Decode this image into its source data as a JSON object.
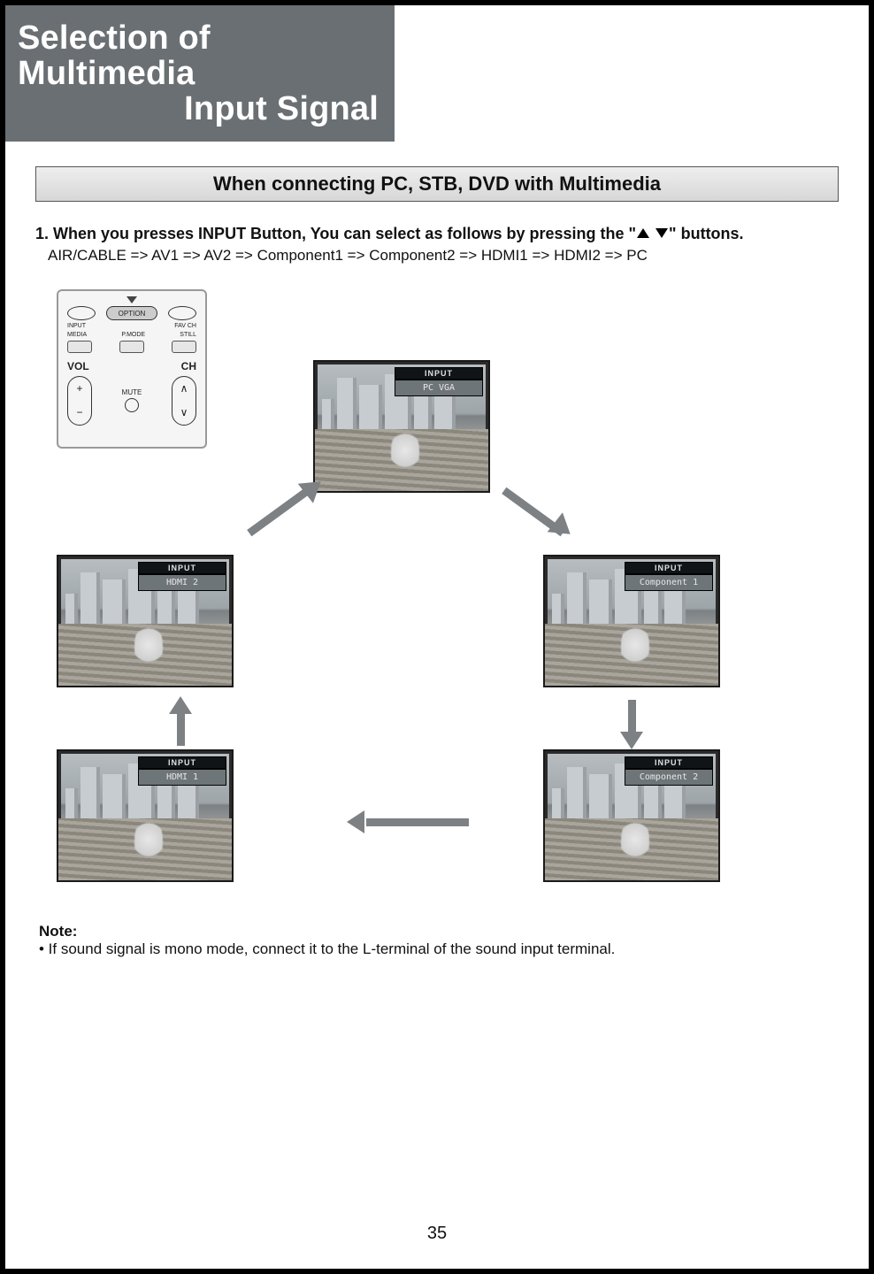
{
  "title": {
    "line1": "Selection of Multimedia",
    "line2": "Input Signal"
  },
  "section_heading": "When connecting PC, STB, DVD with Multimedia",
  "step": {
    "prefix": "1. When you presses INPUT Button, You can select as follows by pressing the \"",
    "suffix": "\" buttons.",
    "sequence": "AIR/CABLE => AV1 => AV2 => Component1 => Component2 => HDMI1 => HDMI2 => PC"
  },
  "remote": {
    "option": "OPTION",
    "input": "INPUT",
    "favch": "FAV CH",
    "media": "MEDIA",
    "pmode": "P.MODE",
    "still": "STILL",
    "vol": "VOL",
    "ch": "CH",
    "mute": "MUTE"
  },
  "overlay_title": "INPUT",
  "tvs": {
    "top": "PC VGA",
    "left1": "HDMI 2",
    "right1": "Component 1",
    "left2": "HDMI 1",
    "right2": "Component 2"
  },
  "note": {
    "label": "Note:",
    "text": "• If sound signal is mono mode, connect it to the L-terminal of the sound input terminal."
  },
  "page_number": "35"
}
